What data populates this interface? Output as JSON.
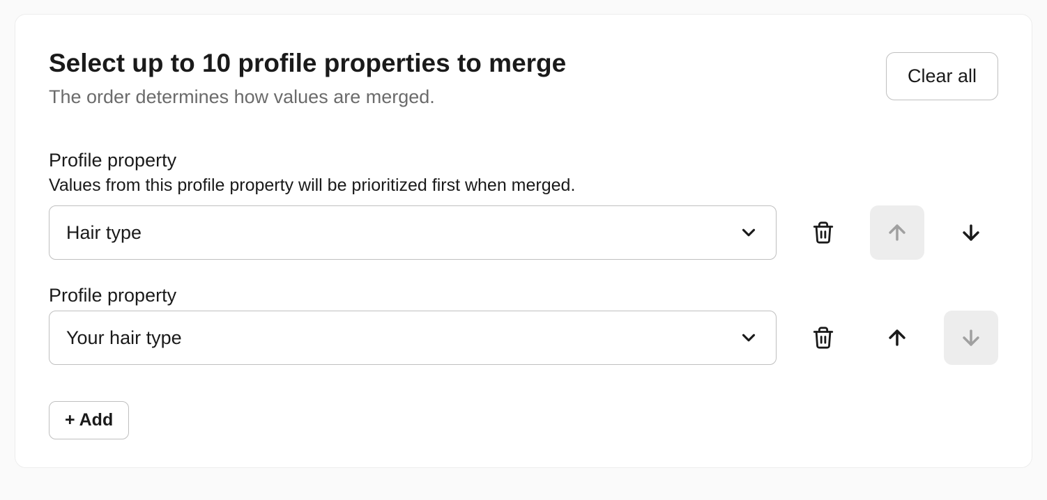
{
  "header": {
    "title": "Select up to 10 profile properties to merge",
    "subtitle": "The order determines how values are merged.",
    "clear_label": "Clear all"
  },
  "properties": [
    {
      "label": "Profile property",
      "helper": "Values from this profile property will be prioritized first when merged.",
      "value": "Hair type",
      "up_disabled": true,
      "down_disabled": false
    },
    {
      "label": "Profile property",
      "helper": "",
      "value": "Your hair type",
      "up_disabled": false,
      "down_disabled": true
    }
  ],
  "add_label": "+ Add"
}
